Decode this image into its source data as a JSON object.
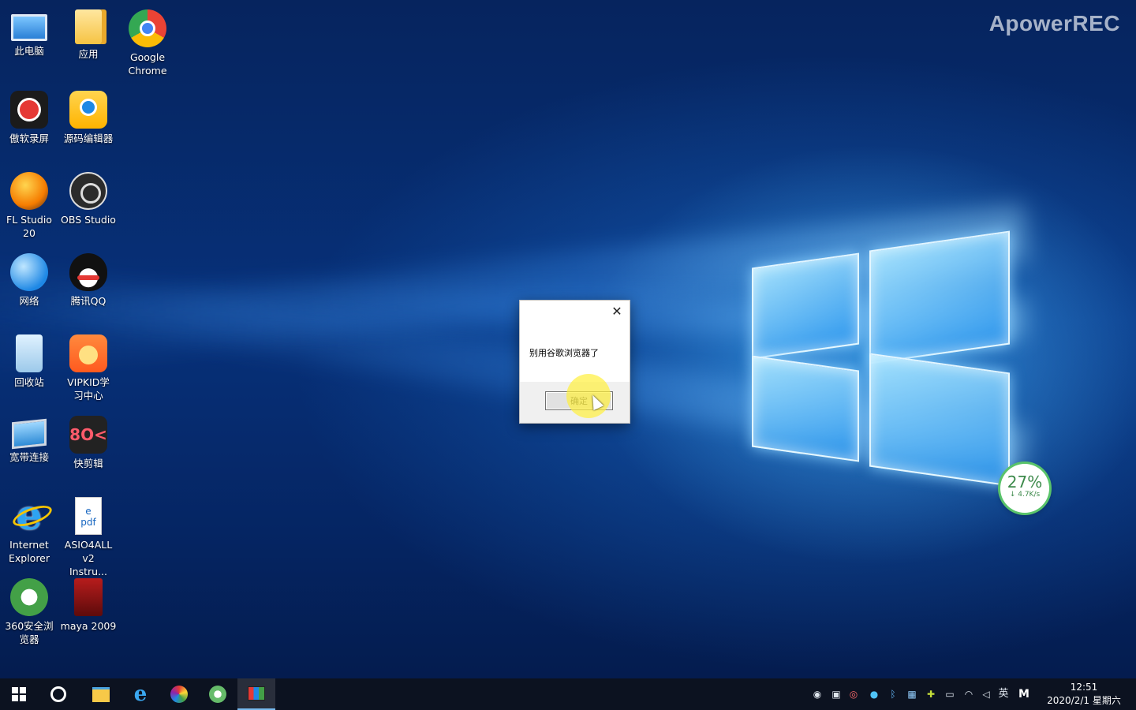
{
  "watermark": "ApowerREC",
  "desktop_icons": [
    {
      "name": "此电脑",
      "icon": "this-pc-icon"
    },
    {
      "name": "应用",
      "icon": "folder-icon"
    },
    {
      "name": "Google Chrome",
      "icon": "chrome-icon"
    },
    {
      "name": "傲软录屏",
      "icon": "screen-recorder-icon"
    },
    {
      "name": "源码编辑器",
      "icon": "code-editor-icon"
    },
    {
      "name": "FL Studio 20",
      "icon": "fl-studio-icon"
    },
    {
      "name": "OBS Studio",
      "icon": "obs-icon"
    },
    {
      "name": "网络",
      "icon": "network-icon"
    },
    {
      "name": "腾讯QQ",
      "icon": "qq-icon"
    },
    {
      "name": "回收站",
      "icon": "recycle-bin-icon"
    },
    {
      "name": "VIPKID学习中心",
      "icon": "vipkid-icon"
    },
    {
      "name": "宽带连接",
      "icon": "broadband-icon"
    },
    {
      "name": "快剪辑",
      "icon": "quick-edit-icon"
    },
    {
      "name": "Internet Explorer",
      "icon": "ie-icon"
    },
    {
      "name": "ASIO4ALL v2 Instru...",
      "icon": "pdf-icon"
    },
    {
      "name": "360安全浏览器",
      "icon": "360-browser-icon"
    },
    {
      "name": "maya 2009",
      "icon": "maya-icon"
    }
  ],
  "dialog": {
    "close_glyph": "✕",
    "message": "别用谷歌浏览器了",
    "ok_label": "确定"
  },
  "net_widget": {
    "percent": "27%",
    "speed": "↓ 4.7K/s"
  },
  "taskbar": {
    "apps": [
      "start-icon",
      "task-view-icon",
      "file-explorer-icon",
      "ie-icon",
      "color-app-icon",
      "360-browser-icon",
      "active-app-icon"
    ],
    "tray": {
      "ime_label": "英",
      "m_label": "M",
      "time": "12:51",
      "date": "2020/2/1 星期六"
    }
  }
}
